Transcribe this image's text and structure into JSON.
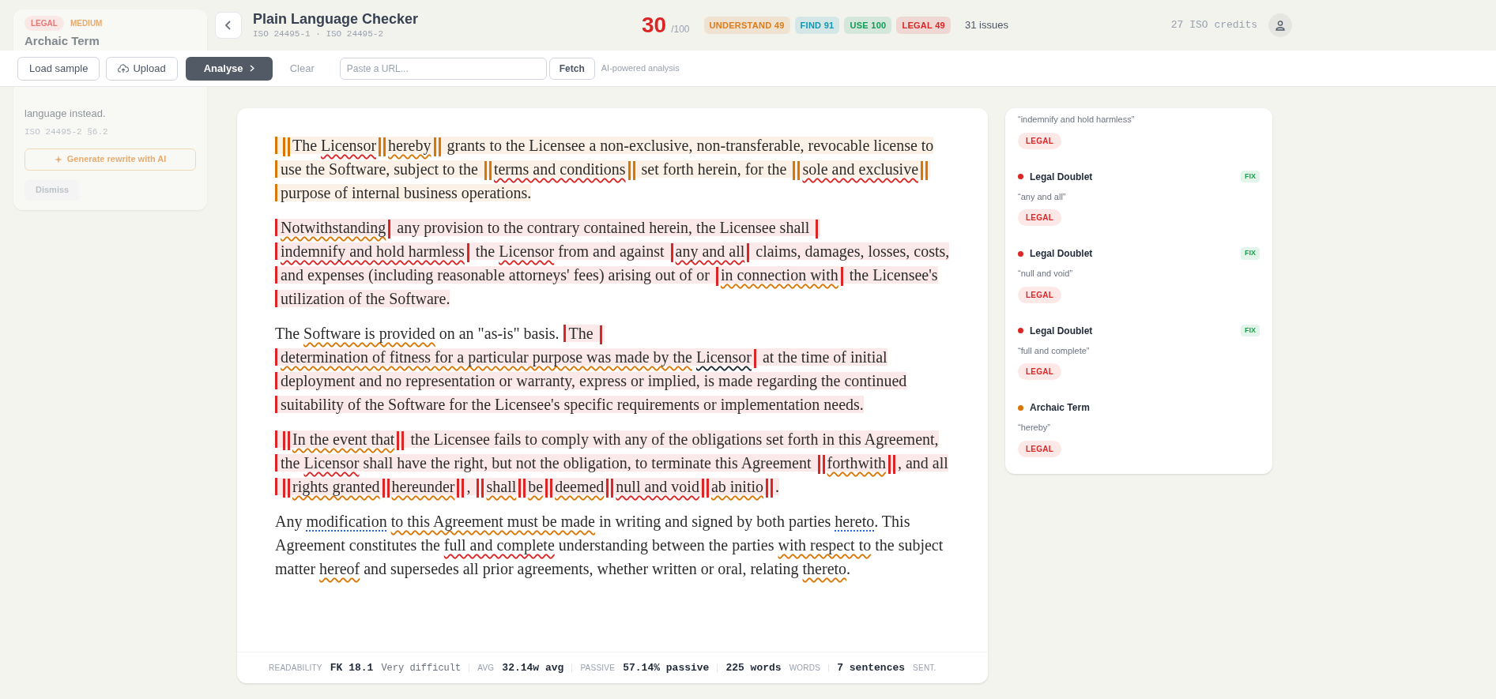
{
  "popup": {
    "badge": "LEGAL",
    "severity": "MEDIUM",
    "title": "Archaic Term",
    "description": "language instead.",
    "reference": "ISO 24495-2 §6.2",
    "rewrite_button": "Generate rewrite with AI",
    "dismiss_button": "Dismiss"
  },
  "header": {
    "title": "Plain Language Checker",
    "subtitle": "ISO 24495-1 · ISO 24495-2",
    "score": "30",
    "score_max": "/100",
    "badges": [
      {
        "label": "UNDERSTAND",
        "value": "49",
        "color": "#e07b1a"
      },
      {
        "label": "FIND",
        "value": "91",
        "color": "#0e97b3"
      },
      {
        "label": "USE",
        "value": "100",
        "color": "#0f9d58"
      },
      {
        "label": "LEGAL",
        "value": "49",
        "color": "#dc2626"
      }
    ],
    "issues": "31 issues",
    "credits": "27 ISO credits"
  },
  "toolbar": {
    "buttons": [
      {
        "label": "Load sample",
        "kind": "outline"
      },
      {
        "label": "Upload",
        "kind": "upload"
      },
      {
        "label": "Analyse",
        "kind": "primary"
      },
      {
        "label": "Clear",
        "kind": "text"
      }
    ],
    "url_field": {
      "placeholder": "Paste a URL..."
    },
    "fetch_button": "Fetch",
    "note": "AI-powered analysis"
  },
  "document": {
    "paragraphs": [
      {
        "parts": [
          {
            "color": "#d97706",
            "runs": [
              {
                "kind": "double_marker"
              },
              {
                "kind": "text",
                "text": "The "
              },
              {
                "kind": "legal",
                "text": "Licensor"
              },
              {
                "kind": "double_marker"
              },
              {
                "kind": "style",
                "text": "hereby"
              },
              {
                "kind": "double_marker"
              },
              {
                "kind": "text",
                "text": " grants to the Licensee a non-exclusive, non-transferable, revocable license to use the Software, subject to the "
              },
              {
                "kind": "double_marker"
              },
              {
                "kind": "legal",
                "text": "terms and conditions"
              },
              {
                "kind": "double_marker"
              },
              {
                "kind": "text",
                "text": " set forth herein, for the "
              },
              {
                "kind": "double_marker"
              },
              {
                "kind": "legal",
                "text": "sole and exclusive"
              },
              {
                "kind": "double_marker"
              },
              {
                "kind": "text",
                "text": " purpose of internal business operations."
              }
            ]
          }
        ]
      },
      {
        "parts": [
          {
            "color": "#dc2626",
            "runs": [
              {
                "kind": "style",
                "text": "Notwithstanding"
              },
              {
                "kind": "marker"
              },
              {
                "kind": "text",
                "text": " any provision to the contrary contained herein, the Licensee shall "
              },
              {
                "kind": "marker"
              },
              {
                "kind": "legal",
                "text": "indemnify and hold harmless"
              },
              {
                "kind": "marker"
              },
              {
                "kind": "text",
                "text": " the "
              },
              {
                "kind": "legal",
                "text": "Licensor"
              },
              {
                "kind": "text",
                "text": " from and against "
              },
              {
                "kind": "marker"
              },
              {
                "kind": "legal",
                "text": "any and all"
              },
              {
                "kind": "marker"
              },
              {
                "kind": "text",
                "text": " claims, damages, losses, costs, and expenses (including reasonable attorneys' fees) arising out of or "
              },
              {
                "kind": "marker"
              },
              {
                "kind": "style",
                "text": "in connection with"
              },
              {
                "kind": "marker"
              },
              {
                "kind": "text",
                "text": " the Licensee's utilization of the Software."
              }
            ]
          }
        ]
      },
      {
        "parts": [
          {
            "runs": [
              {
                "kind": "text",
                "text": "The "
              },
              {
                "kind": "style",
                "text": "Software is provided"
              },
              {
                "kind": "text",
                "text": " on an \"as-is\" basis."
              }
            ]
          },
          {
            "color": "#dc2626",
            "runs": [
              {
                "kind": "text",
                "text": "The "
              },
              {
                "kind": "marker"
              },
              {
                "kind": "style",
                "text": "determination of fitness for a particular purpose was made by the"
              },
              {
                "kind": "term",
                "text": "Licensor"
              },
              {
                "kind": "marker"
              },
              {
                "kind": "text",
                "text": " at the time of initial deployment and no representation or warranty, express or implied, is made regarding the continued suitability of the Software for the Licensee's specific requirements or implementation needs."
              }
            ]
          }
        ]
      },
      {
        "parts": [
          {
            "color": "#dc2626",
            "runs": [
              {
                "kind": "double_marker"
              },
              {
                "kind": "style",
                "text": "In the event that"
              },
              {
                "kind": "double_marker"
              },
              {
                "kind": "text",
                "text": " the Licensee fails to comply with any of the obligations set forth in this Agreement, the "
              },
              {
                "kind": "legal",
                "text": "Licensor"
              },
              {
                "kind": "text",
                "text": " shall have the right, but not the obligation, to terminate this Agreement "
              },
              {
                "kind": "double_marker"
              },
              {
                "kind": "style",
                "text": "forthwith"
              },
              {
                "kind": "double_marker"
              },
              {
                "kind": "text",
                "text": ", and all "
              },
              {
                "kind": "double_marker"
              },
              {
                "kind": "style",
                "text": "rights granted"
              },
              {
                "kind": "double_marker"
              },
              {
                "kind": "style",
                "text": "hereunder"
              },
              {
                "kind": "double_marker"
              },
              {
                "kind": "text",
                "text": ", "
              },
              {
                "kind": "double_marker"
              },
              {
                "kind": "style",
                "text": "shall"
              },
              {
                "kind": "double_marker"
              },
              {
                "kind": "style",
                "text": "be"
              },
              {
                "kind": "double_marker"
              },
              {
                "kind": "style",
                "text": "deemed"
              },
              {
                "kind": "double_marker"
              },
              {
                "kind": "legal",
                "text": "null and void"
              },
              {
                "kind": "double_marker"
              },
              {
                "kind": "style",
                "text": "ab initio"
              },
              {
                "kind": "double_marker"
              },
              {
                "kind": "text",
                "text": "."
              }
            ]
          }
        ]
      },
      {
        "parts": [
          {
            "runs": [
              {
                "kind": "text",
                "text": "Any "
              },
              {
                "kind": "hint",
                "text": "modification"
              },
              {
                "kind": "style",
                "text": "to this Agreement must be made"
              },
              {
                "kind": "text",
                "text": " in writing and signed by both parties "
              },
              {
                "kind": "hint",
                "text": "hereto"
              },
              {
                "kind": "text",
                "text": ". This Agreement constitutes the "
              },
              {
                "kind": "legal",
                "text": "full and complete"
              },
              {
                "kind": "text",
                "text": " understanding between the parties "
              },
              {
                "kind": "style",
                "text": "with respect to"
              },
              {
                "kind": "text",
                "text": " the subject matter "
              },
              {
                "kind": "style",
                "text": "hereof"
              },
              {
                "kind": "text",
                "text": " and supersedes all prior agreements, whether written or oral, relating "
              },
              {
                "kind": "style",
                "text": "thereto"
              },
              {
                "kind": "text",
                "text": "."
              }
            ]
          }
        ]
      }
    ]
  },
  "stats": [
    {
      "kind": "prefix",
      "label": "READABILITY",
      "value": "FK 18.1",
      "detail": "Very difficult"
    },
    {
      "kind": "prefix",
      "label": "AVG",
      "value": "32.14w avg"
    },
    {
      "kind": "prefix",
      "label": "PASSIVE",
      "value": "57.14% passive"
    },
    {
      "kind": "suffix",
      "label": "WORDS",
      "value": "225 words"
    },
    {
      "kind": "suffix",
      "label": "SENT.",
      "value": "7 sentences"
    }
  ],
  "issues_panel": {
    "items": [
      {
        "quote": "“indemnify and hold harmless”",
        "tag": "LEGAL"
      },
      {
        "title": "Legal Doublet",
        "color": "#dc2626",
        "fix": "FIX",
        "quote": "“any and all”",
        "tag": "LEGAL"
      },
      {
        "title": "Legal Doublet",
        "color": "#dc2626",
        "fix": "FIX",
        "quote": "“null and void”",
        "tag": "LEGAL"
      },
      {
        "title": "Legal Doublet",
        "color": "#dc2626",
        "fix": "FIX",
        "quote": "“full and complete”",
        "tag": "LEGAL"
      },
      {
        "title": "Archaic Term",
        "color": "#d97706",
        "quote": "“hereby”",
        "tag": "LEGAL"
      }
    ]
  }
}
